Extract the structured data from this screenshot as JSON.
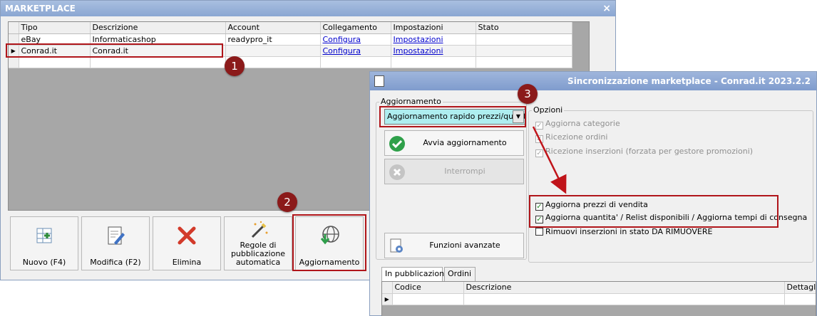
{
  "marketplace": {
    "title": "MARKETPLACE",
    "close": "×",
    "columns": [
      "Tipo",
      "Descrizione",
      "Account",
      "Collegamento",
      "Impostazioni",
      "Stato"
    ],
    "rows": [
      {
        "tipo": "eBay",
        "descrizione": "Informaticashop",
        "account": "readypro_it",
        "collegamento": "Configura",
        "impostazioni": "Impostazioni",
        "stato": ""
      },
      {
        "tipo": "Conrad.it",
        "descrizione": "Conrad.it",
        "account": "",
        "collegamento": "Configura",
        "impostazioni": "Impostazioni",
        "stato": ""
      }
    ],
    "row_indicator": "▶",
    "toolbar": {
      "nuovo": "Nuovo (F4)",
      "modifica": "Modifica (F2)",
      "elimina": "Elimina",
      "regole": "Regole di pubblicazione automatica",
      "aggiornamento": "Aggiornamento"
    }
  },
  "sync": {
    "title": "Sincronizzazione marketplace - Conrad.it 2023.2.2",
    "aggiornamento_legend": "Aggiornamento",
    "combo_value": "Aggiornamento rapido prezzi/quantità",
    "combo_arrow": "▼",
    "avvia": "Avvia aggiornamento",
    "interrompi": "Interrompi",
    "funzioni": "Funzioni avanzate",
    "opzioni_legend": "Opzioni",
    "check_mark": "✓",
    "options": [
      {
        "label": "Aggiorna categorie",
        "checked": true,
        "disabled": true
      },
      {
        "label": "Ricezione ordini",
        "checked": true,
        "disabled": true
      },
      {
        "label": "Ricezione inserzioni (forzata per gestore promozioni)",
        "checked": true,
        "disabled": true
      },
      {
        "label": "Aggiorna prezzi di vendita",
        "checked": true,
        "disabled": false
      },
      {
        "label": "Aggiorna quantita' / Relist disponibili / Aggiorna tempi di consegna",
        "checked": true,
        "disabled": false
      },
      {
        "label": "Rimuovi inserzioni in stato DA RIMUOVERE",
        "checked": false,
        "disabled": false
      }
    ],
    "tabs": [
      "In pubblicazione",
      "Ordini"
    ],
    "grid_columns": [
      "Codice",
      "Descrizione",
      "Dettagli"
    ],
    "row_indicator": "▶"
  },
  "badges": [
    "1",
    "2",
    "3"
  ],
  "colors": {
    "highlight": "#b0151a",
    "badge": "#8b1a1a",
    "title_bar": "#8aa6d2",
    "combo_bg": "#aeeef0"
  }
}
